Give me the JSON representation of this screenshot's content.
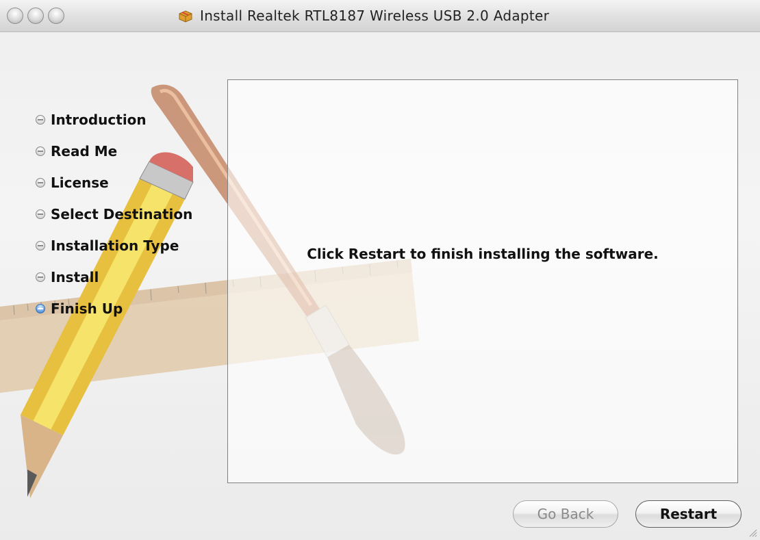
{
  "window": {
    "title": "Install Realtek RTL8187 Wireless USB 2.0 Adapter",
    "title_icon": "package-icon"
  },
  "sidebar": {
    "steps": [
      {
        "label": "Introduction",
        "state": "done"
      },
      {
        "label": "Read Me",
        "state": "done"
      },
      {
        "label": "License",
        "state": "done"
      },
      {
        "label": "Select Destination",
        "state": "done"
      },
      {
        "label": "Installation Type",
        "state": "done"
      },
      {
        "label": "Install",
        "state": "done"
      },
      {
        "label": "Finish Up",
        "state": "current"
      }
    ]
  },
  "content": {
    "message": "Click Restart to finish installing the software."
  },
  "buttons": {
    "back_label": "Go Back",
    "back_enabled": false,
    "restart_label": "Restart",
    "restart_default": true
  },
  "colors": {
    "current_step_bullet": "#3d73b8"
  }
}
